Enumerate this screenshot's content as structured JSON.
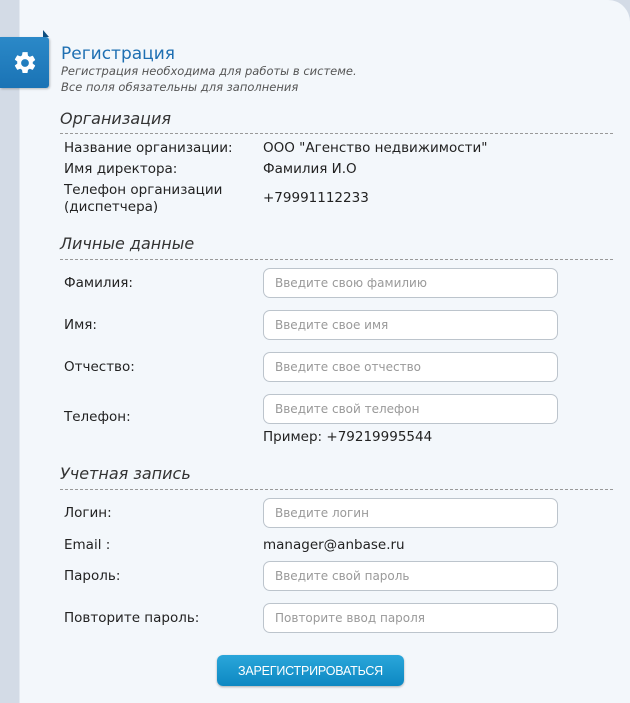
{
  "header": {
    "title": "Регистрация",
    "subtitle_line1": "Регистрация необходима для работы в системе.",
    "subtitle_line2": "Все поля обязательны для заполнения",
    "icon": "gear-icon"
  },
  "organization": {
    "section_title": "Организация",
    "name_label": "Название организации:",
    "name_value": "ООО \"Агенство недвижимости\"",
    "director_label": "Имя директора:",
    "director_value": "Фамилия И.О",
    "phone_label_line1": "Телефон организации",
    "phone_label_line2": "(диспетчера)",
    "phone_value": "+79991112233"
  },
  "personal": {
    "section_title": "Личные данные",
    "lastname_label": "Фамилия:",
    "lastname_placeholder": "Введите свою фамилию",
    "firstname_label": "Имя:",
    "firstname_placeholder": "Введите свое имя",
    "patronymic_label": "Отчество:",
    "patronymic_placeholder": "Введите свое отчество",
    "phone_label": "Телефон:",
    "phone_placeholder": "Введите свой телефон",
    "phone_example": "Пример: +79219995544"
  },
  "account": {
    "section_title": "Учетная запись",
    "login_label": "Логин:",
    "login_placeholder": "Введите логин",
    "email_label": "Email :",
    "email_value": "manager@anbase.ru",
    "password_label": "Пароль:",
    "password_placeholder": "Введите свой пароль",
    "repeat_label": "Повторите пароль:",
    "repeat_placeholder": "Повторите ввод пароля"
  },
  "submit_label": "ЗАРЕГИСТРИРОВАТЬСЯ",
  "colors": {
    "accent": "#1e6fb2",
    "tab": "#1a73b5",
    "button": "#1897cf"
  }
}
